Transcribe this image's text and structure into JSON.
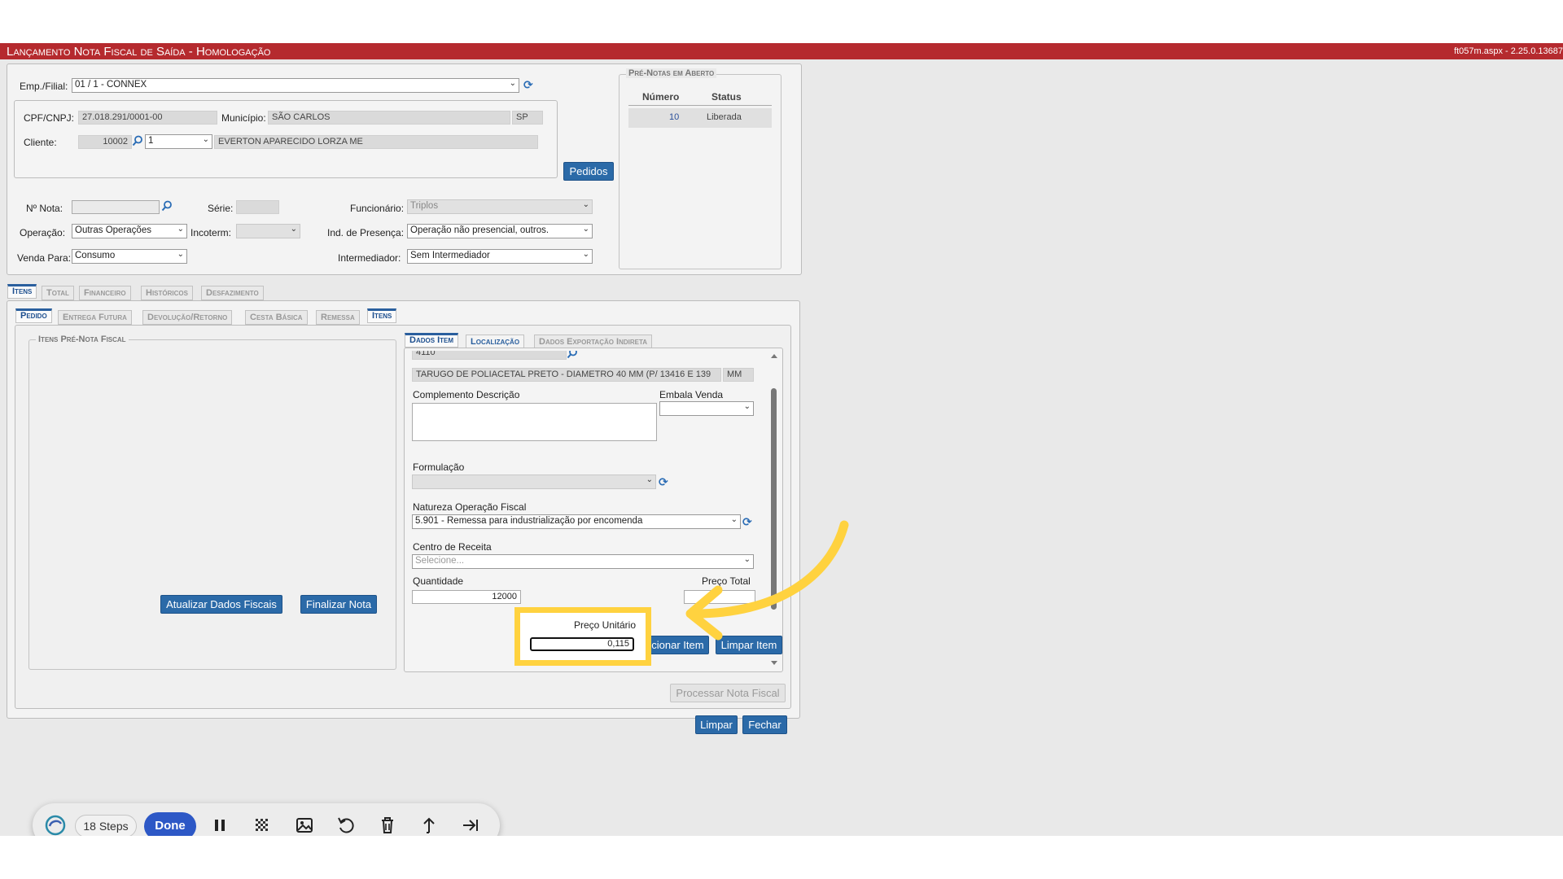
{
  "header": {
    "title": "Lançamento Nota Fiscal de Saída  - Homologação",
    "version": "ft057m.aspx - 2.25.0.13687"
  },
  "company": {
    "label": "Emp./Filial:",
    "value": "01 / 1 - CONNEX"
  },
  "client": {
    "cpf_label": "CPF/CNPJ:",
    "cpf_value": "27.018.291/0001-00",
    "municipio_label": "Município:",
    "municipio_value": "SÃO CARLOS",
    "uf": "SP",
    "cliente_label": "Cliente:",
    "cliente_code": "10002",
    "cliente_seq": "1",
    "cliente_name": "EVERTON APARECIDO LORZA ME"
  },
  "pedidos_button": "Pedidos",
  "nota": {
    "numero_label": "Nº Nota:",
    "serie_label": "Série:",
    "funcionario_label": "Funcionário:",
    "funcionario_value": "Triplos",
    "operacao_label": "Operação:",
    "operacao_value": "Outras Operações",
    "incoterm_label": "Incoterm:",
    "presenca_label": "Ind. de Presença:",
    "presenca_value": "Operação não presencial, outros.",
    "venda_label": "Venda Para:",
    "venda_value": "Consumo",
    "intermediador_label": "Intermediador:",
    "intermediador_value": "Sem Intermediador"
  },
  "prenotas": {
    "legend": "Pré-Notas em Aberto",
    "col_numero": "Número",
    "col_status": "Status",
    "rows": [
      {
        "numero": "10",
        "status": "Liberada"
      }
    ]
  },
  "main_tabs": [
    "Itens",
    "Total",
    "Financeiro",
    "Históricos",
    "Desfazimento"
  ],
  "sub_tabs": [
    "Pedido",
    "Entrega Futura",
    "Devolução/Retorno",
    "Cesta Básica",
    "Remessa",
    "Itens"
  ],
  "itens_prenota_legend": "Itens Pré-Nota Fiscal",
  "item_tabs": [
    "Dados Item",
    "Localização",
    "Dados Exportação Indireta"
  ],
  "item": {
    "code_partial": "4110",
    "description": "TARUGO DE POLIACETAL PRETO - DIAMETRO 40 MM (P/ 13416 E 139",
    "unit": "MM",
    "complemento_label": "Complemento Descrição",
    "embala_label": "Embala Venda",
    "formulacao_label": "Formulação",
    "natureza_label": "Natureza Operação Fiscal",
    "natureza_value": "5.901 - Remessa para industrialização por encomenda",
    "centro_label": "Centro de Receita",
    "centro_placeholder": "Selecione...",
    "quantidade_label": "Quantidade",
    "quantidade_value": "12000",
    "preco_label": "Preço Unitário",
    "preco_value": "0,115",
    "total_label": "Preço Total"
  },
  "buttons": {
    "atualizar": "Atualizar Dados Fiscais",
    "finalizar": "Finalizar Nota",
    "adicionar": "Adicionar Item",
    "limpar_item": "Limpar Item",
    "processar": "Processar Nota Fiscal",
    "limpar": "Limpar",
    "fechar": "Fechar"
  },
  "recorder": {
    "steps": "18 Steps",
    "done": "Done"
  },
  "colors": {
    "title_bar": "#b52a2e",
    "button": "#2b6aa8",
    "highlight": "#ffd23f",
    "arrow": "#ffd23f"
  }
}
